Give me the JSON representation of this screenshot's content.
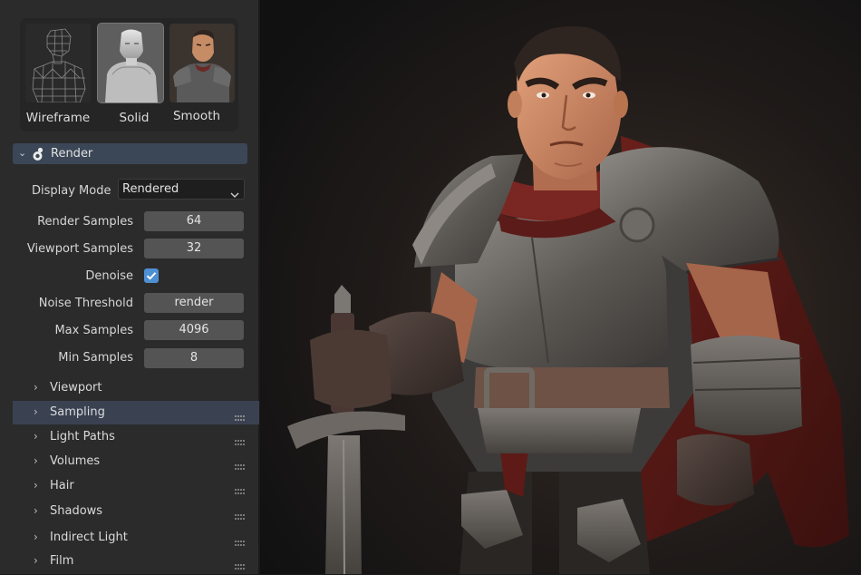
{
  "shading": {
    "options": [
      {
        "label": "Wireframe",
        "icon": "wireframe-shading-icon"
      },
      {
        "label": "Solid",
        "icon": "solid-shading-icon"
      },
      {
        "label": "Smooth",
        "icon": "smooth-shading-icon"
      }
    ],
    "active": "Solid"
  },
  "render_panel": {
    "title": "Render",
    "display_mode_label": "Display Mode",
    "display_mode_value": "Rendered",
    "render_samples_label": "Render Samples",
    "render_samples_value": "64",
    "viewport_samples_label": "Viewport Samples",
    "viewport_samples_value": "32",
    "denoise_label": "Denoise",
    "denoise_checked": true,
    "noise_threshold_label": "Noise Threshold",
    "noise_threshold_value": "render",
    "max_samples_label": "Max Samples",
    "max_samples_value": "4096",
    "min_samples_label": "Min Samples",
    "min_samples_value": "8"
  },
  "subpanels": [
    {
      "label": "Viewport",
      "highlighted": false,
      "grip": false
    },
    {
      "label": "Sampling",
      "highlighted": true,
      "grip": true
    },
    {
      "label": "Light Paths",
      "highlighted": false,
      "grip": true
    },
    {
      "label": "Volumes",
      "highlighted": false,
      "grip": true
    },
    {
      "label": "Hair",
      "highlighted": false,
      "grip": true
    },
    {
      "label": "Shadows",
      "highlighted": false,
      "grip": true
    },
    {
      "label": "Indirect Light",
      "highlighted": false,
      "grip": true
    },
    {
      "label": "Film",
      "highlighted": false,
      "grip": true
    }
  ],
  "colors": {
    "panel_bg": "#2b2b2b",
    "header_bg": "#3b4656",
    "field_bg": "#545454",
    "checkbox_accent": "#4e8fd3",
    "highlight_row": "#3a4252"
  }
}
